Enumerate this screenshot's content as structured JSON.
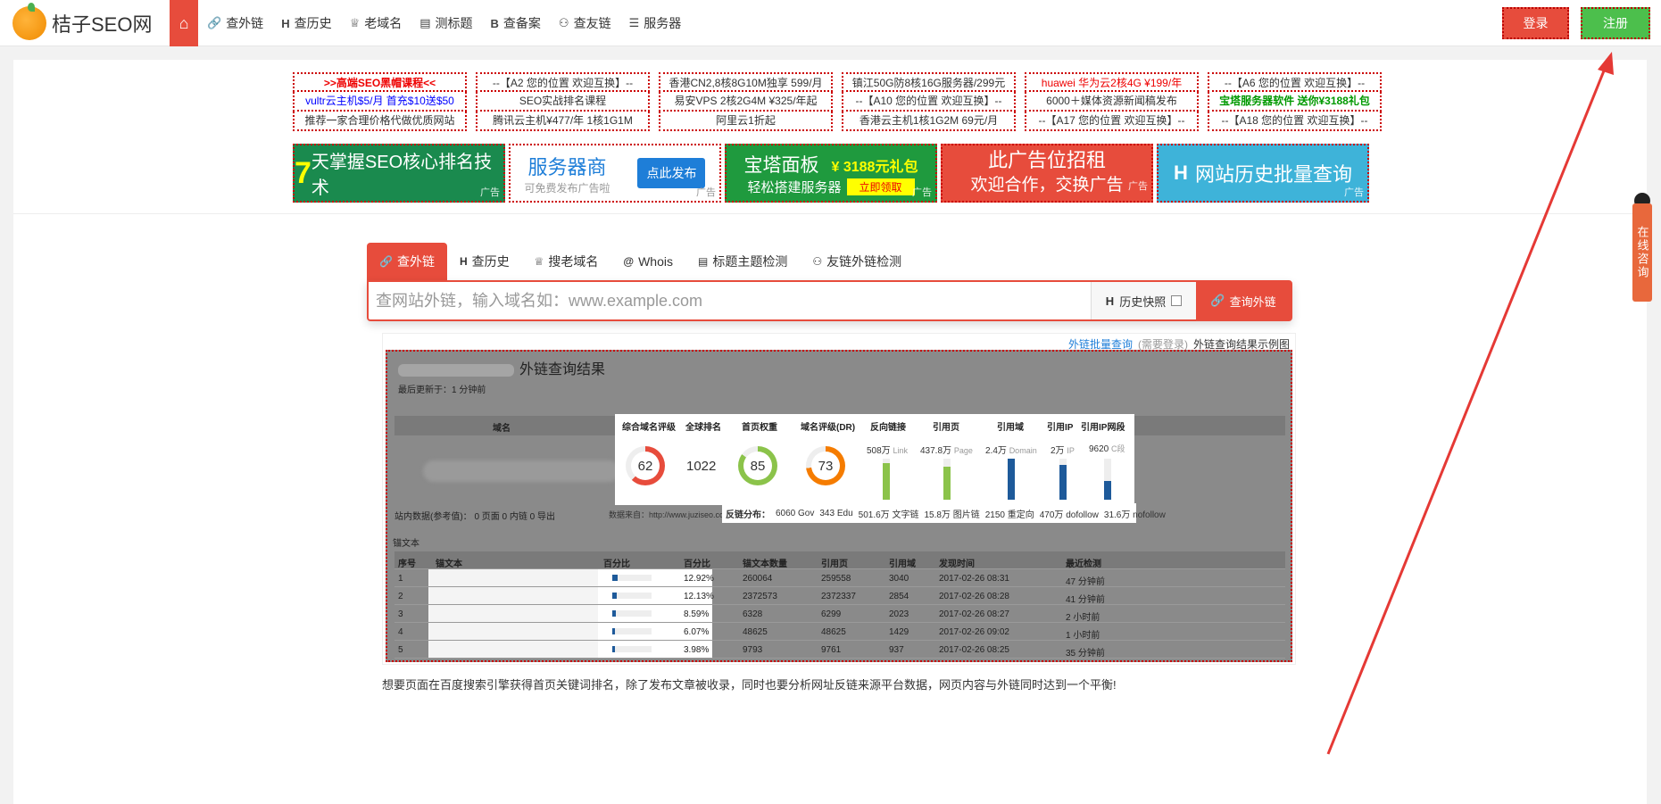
{
  "brand": {
    "name": "桔子SEO网"
  },
  "nav": {
    "items": [
      {
        "icon": "link-icon",
        "glyph": "🔗",
        "label": "查外链"
      },
      {
        "icon": "history-h-icon",
        "glyph": "H",
        "label": "查历史"
      },
      {
        "icon": "trophy-icon",
        "glyph": "♕",
        "label": "老域名"
      },
      {
        "icon": "document-icon",
        "glyph": "▤",
        "label": "测标题"
      },
      {
        "icon": "beian-b-icon",
        "glyph": "B",
        "label": "查备案"
      },
      {
        "icon": "friends-icon",
        "glyph": "⚇",
        "label": "查友链"
      },
      {
        "icon": "list-icon",
        "glyph": "☰",
        "label": "服务器"
      }
    ],
    "login": "登录",
    "register": "注册"
  },
  "text_ads": [
    [
      ">>高端SEO黑帽课程<<",
      "vultr云主机$5/月 首充$10送$50",
      "推荐一家合理价格代做优质网站"
    ],
    [
      "--【A2 您的位置 欢迎互换】--",
      "SEO实战排名课程",
      "腾讯云主机¥477/年 1核1G1M"
    ],
    [
      "香港CN2,8核8G10M独享 599/月",
      "易安VPS 2核2G4M ¥325/年起",
      "阿里云1折起"
    ],
    [
      "镇江50G防8核16G服务器/299元",
      "--【A10 您的位置 欢迎互换】--",
      "香港云主机1核1G2M 69元/月"
    ],
    [
      "huawei 华为云2核4G ¥199/年",
      "6000＋媒体资源新闻稿发布",
      "--【A17 您的位置 欢迎互换】--"
    ],
    [
      "--【A6 您的位置 欢迎互换】--",
      "宝塔服务器软件 送你¥3188礼包",
      "--【A18 您的位置 欢迎互换】--"
    ]
  ],
  "banners": {
    "b1": {
      "num": "7",
      "text": "天掌握SEO核心排名技术",
      "tag": "广告"
    },
    "b2": {
      "title": "服务器商",
      "sub": "可免费发布广告啦",
      "btn": "点此发布",
      "tag": "广告"
    },
    "b3": {
      "title": "宝塔面板",
      "price": "¥ 3188元礼包",
      "sub": "轻松搭建服务器",
      "btn": "立即领取",
      "tag": "广告"
    },
    "b4": {
      "line1": "此广告位招租",
      "line2": "欢迎合作，交换广告",
      "tag": "广告"
    },
    "b5": {
      "text": "网站历史批量查询",
      "tag": "广告"
    }
  },
  "tabs": [
    {
      "icon": "link-icon",
      "glyph": "🔗",
      "label": "查外链",
      "active": true
    },
    {
      "icon": "history-h-icon",
      "glyph": "H",
      "label": "查历史"
    },
    {
      "icon": "trophy-icon",
      "glyph": "♕",
      "label": "搜老域名"
    },
    {
      "icon": "at-icon",
      "glyph": "@",
      "label": "Whois"
    },
    {
      "icon": "document-icon",
      "glyph": "▤",
      "label": "标题主题检测"
    },
    {
      "icon": "friends-icon",
      "glyph": "⚇",
      "label": "友链外链检测"
    }
  ],
  "search": {
    "placeholder": "查网站外链，输入域名如：www.example.com",
    "history_label": "历史快照",
    "button": "查询外链"
  },
  "sample": {
    "batch_link": "外链批量查询",
    "need_login": "(需要登录)",
    "caption": "外链查询结果示例图",
    "title": "外链查询结果",
    "updated": "最后更新于：1 分钟前",
    "headers": [
      "域名",
      "综合域名评级",
      "全球排名",
      "首页权重",
      "域名评级(DR)",
      "反向链接",
      "引用页",
      "引用域",
      "引用IP",
      "引用IP网段"
    ],
    "metrics": {
      "composite": "62",
      "global_rank": "1022",
      "home_weight": "85",
      "dr": "73",
      "backlinks": "508万",
      "backlinks_unit": "Link",
      "backlinks_fill": 0.9,
      "ref_pages": "437.8万",
      "ref_pages_unit": "Page",
      "ref_pages_fill": 0.8,
      "ref_domains": "2.4万",
      "ref_domains_unit": "Domain",
      "ref_domains_fill": 1.0,
      "ref_ips": "2万",
      "ref_ips_unit": "IP",
      "ref_ips_fill": 0.85,
      "ref_subnets": "9620",
      "ref_subnets_unit": "C段",
      "ref_subnets_fill": 0.45
    },
    "stats": "站内数据(参考值)： 0 页面   0 内链   0 导出",
    "source": "数据来自：http://www.juziseo.com",
    "dist": {
      "label": "反链分布：",
      "items": [
        "6060 Gov",
        "343 Edu",
        "501.6万 文字链",
        "15.8万 图片链",
        "2150 重定向",
        "470万 dofollow",
        "31.6万 nofollow"
      ]
    },
    "anchor_label": "锚文本",
    "table_headers": [
      "序号",
      "锚文本",
      "百分比",
      "百分比",
      "锚文本数量",
      "引用页",
      "引用域",
      "发现时间",
      "最近检测"
    ],
    "rows": [
      {
        "no": "1",
        "pct_fill": 0.13,
        "pct": "12.92%",
        "count": "260064",
        "pages": "259558",
        "domains": "3040",
        "found": "2017-02-26 08:31",
        "checked": "47 分钟前"
      },
      {
        "no": "2",
        "pct_fill": 0.12,
        "pct": "12.13%",
        "count": "2372573",
        "pages": "2372337",
        "domains": "2854",
        "found": "2017-02-26 08:28",
        "checked": "41 分钟前"
      },
      {
        "no": "3",
        "pct_fill": 0.09,
        "pct": "8.59%",
        "count": "6328",
        "pages": "6299",
        "domains": "2023",
        "found": "2017-02-26 08:27",
        "checked": "2 小时前"
      },
      {
        "no": "4",
        "pct_fill": 0.06,
        "pct": "6.07%",
        "count": "48625",
        "pages": "48625",
        "domains": "1429",
        "found": "2017-02-26 09:02",
        "checked": "1 小时前"
      },
      {
        "no": "5",
        "pct_fill": 0.04,
        "pct": "3.98%",
        "count": "9793",
        "pages": "9761",
        "domains": "937",
        "found": "2017-02-26 08:25",
        "checked": "35 分钟前"
      }
    ]
  },
  "description": "想要页面在百度搜索引擎获得首页关键词排名，除了发布文章被收录，同时也要分析网址反链来源平台数据，网页内容与外链同时达到一个平衡!",
  "consult": "在线咨询"
}
